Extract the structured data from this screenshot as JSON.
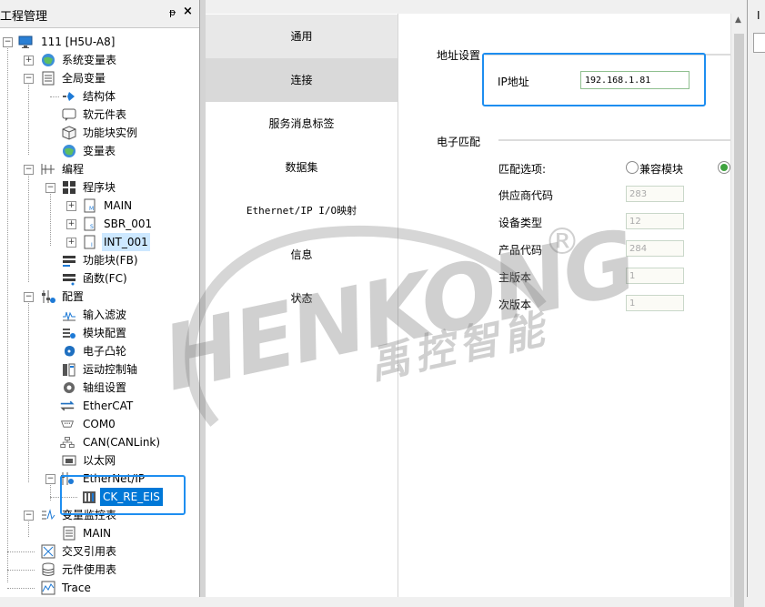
{
  "left_panel": {
    "title": "工程管理",
    "pin_glyph": "ᵽ",
    "close_glyph": "×"
  },
  "tree": {
    "root": "111 [H5U-A8]",
    "sys_vars": "系统变量表",
    "global_vars": "全局变量",
    "struct": "结构体",
    "soft_elements": "软元件表",
    "fb_instances": "功能块实例",
    "var_table": "变量表",
    "programming": "编程",
    "program_blocks": "程序块",
    "main": "MAIN",
    "sbr": "SBR_001",
    "int": "INT_001",
    "fb": "功能块(FB)",
    "fc": "函数(FC)",
    "config": "配置",
    "input_filter": "输入滤波",
    "module_config": "模块配置",
    "ecam": "电子凸轮",
    "motion_axis": "运动控制轴",
    "axis_group": "轴组设置",
    "ethercat": "EtherCAT",
    "com0": "COM0",
    "can": "CAN(CANLink)",
    "ethernet": "以太网",
    "ethernetip": "EtherNet/IP",
    "ck_re_eis": "CK_RE_EIS",
    "var_monitor": "变量监控表",
    "monitor_main": "MAIN",
    "cross_ref": "交叉引用表",
    "element_usage": "元件使用表",
    "trace": "Trace"
  },
  "nav": {
    "general": "通用",
    "connection": "连接",
    "service_tags": "服务消息标签",
    "dataset": "数据集",
    "io_mapping": "Ethernet/IP I/O映射",
    "info": "信息",
    "status": "状态"
  },
  "form": {
    "addr_section": "地址设置",
    "ip_label": "IP地址",
    "ip_value": "192.168.1.81",
    "match_section": "电子匹配",
    "match_option_label": "匹配选项:",
    "compatible_module": "兼容模块",
    "vendor_code_label": "供应商代码",
    "vendor_code": "283",
    "device_type_label": "设备类型",
    "device_type": "12",
    "product_code_label": "产品代码",
    "product_code": "284",
    "major_rev_label": "主版本",
    "major_rev": "1",
    "minor_rev_label": "次版本",
    "minor_rev": "1"
  },
  "far_right": {
    "label": "I"
  },
  "watermark": {
    "brand": "HENKONG",
    "brand_cn": "禹控智能",
    "reg": "®"
  },
  "colors": {
    "selection": "#0078d7",
    "callout": "#1e8ef0",
    "radio_on": "#3fa33f"
  }
}
